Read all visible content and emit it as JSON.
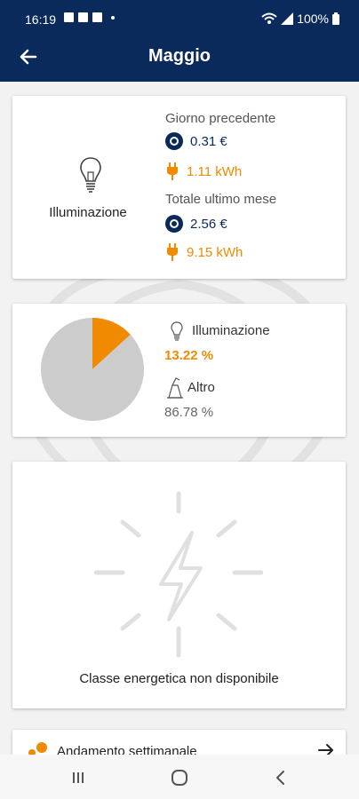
{
  "status": {
    "time": "16:19",
    "battery": "100%"
  },
  "header": {
    "title": "Maggio"
  },
  "summary": {
    "category": "Illuminazione",
    "prev_day_label": "Giorno precedente",
    "prev_day_cost": "0.31 €",
    "prev_day_energy": "1.11 kWh",
    "last_month_label": "Totale ultimo mese",
    "last_month_cost": "2.56 €",
    "last_month_energy": "9.15 kWh"
  },
  "breakdown": {
    "item1_label": "Illuminazione",
    "item1_value": "13.22 %",
    "item2_label": "Altro",
    "item2_value": "86.78 %"
  },
  "chart_data": {
    "type": "pie",
    "categories": [
      "Illuminazione",
      "Altro"
    ],
    "values": [
      13.22,
      86.78
    ],
    "colors": [
      "#f08a00",
      "#cccccc"
    ]
  },
  "energy_class": {
    "text": "Classe energetica non disponibile"
  },
  "weekly": {
    "label": "Andamento settimanale"
  },
  "colors": {
    "brand": "#0b2a5c",
    "accent": "#f08a00"
  }
}
